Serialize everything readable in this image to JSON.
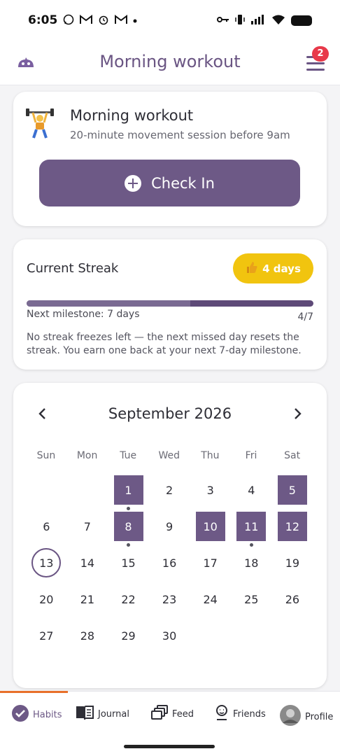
{
  "status_bar": {
    "time": "6:05"
  },
  "header": {
    "title": "Morning workout",
    "badge_count": "2"
  },
  "habit": {
    "title": "Morning workout",
    "subtitle": "20-minute movement session before 9am",
    "checkin_label": "Check In"
  },
  "streak": {
    "title": "Current Streak",
    "badge": "4 days",
    "milestone_label": "Next milestone: 7 days",
    "progress_text": "4/7",
    "progress_value": 0.57,
    "note": "No streak freezes left — the next missed day resets the streak. You earn one back at your next 7-day milestone."
  },
  "calendar": {
    "month": "September 2026",
    "prev_icon": "chevron-left-icon",
    "next_icon": "chevron-right-icon",
    "weekdays": [
      "Sun",
      "Mon",
      "Tue",
      "Wed",
      "Thu",
      "Fri",
      "Sat"
    ],
    "first_weekday": 2,
    "days_in_month": 30,
    "completed_days": [
      1,
      5,
      8,
      10,
      11,
      12
    ],
    "dotted_days": [
      1,
      8,
      11
    ],
    "today": 13
  },
  "nav": {
    "items": [
      {
        "label": "Habits",
        "icon": "check-circle-icon"
      },
      {
        "label": "Journal",
        "icon": "book-icon"
      },
      {
        "label": "Feed",
        "icon": "stack-icon"
      },
      {
        "label": "Friends",
        "icon": "friends-icon"
      },
      {
        "label": "Profile",
        "icon": "avatar"
      }
    ]
  },
  "colors": {
    "accent": "#6d5986",
    "streak_badge": "#f1c40f",
    "notification": "#e8394a",
    "active_tab": "#e8702a"
  }
}
